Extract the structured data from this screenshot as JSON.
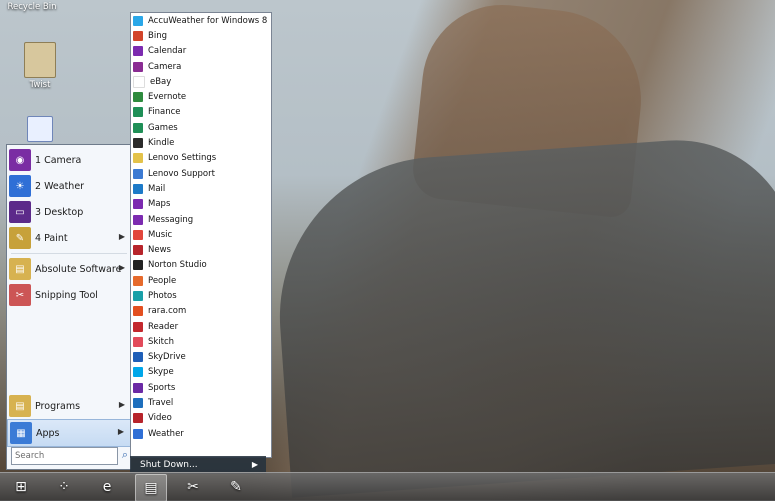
{
  "desktop": {
    "icons": [
      {
        "label": "Recycle Bin",
        "icon": "recycle-bin-icon"
      },
      {
        "label": "Twist",
        "icon": "folder-icon"
      },
      {
        "label": "",
        "icon": "app-icon"
      }
    ]
  },
  "start_menu": {
    "left_items": [
      {
        "label": "1 Camera",
        "icon": "camera-icon",
        "color": "#7a2da3",
        "has_arrow": false
      },
      {
        "label": "2 Weather",
        "icon": "weather-icon",
        "color": "#2f6fd6",
        "has_arrow": false
      },
      {
        "label": "3 Desktop",
        "icon": "desktop-icon",
        "color": "#5c2a8a",
        "has_arrow": false
      },
      {
        "label": "4 Paint",
        "icon": "paint-icon",
        "color": "#c7a13a",
        "has_arrow": true
      },
      {
        "label": "Absolute Software",
        "icon": "folder-icon",
        "color": "#d7b250",
        "has_arrow": true
      },
      {
        "label": "Snipping Tool",
        "icon": "scissors-icon",
        "color": "#c55",
        "has_arrow": false
      }
    ],
    "bottom_items": [
      {
        "label": "Programs",
        "icon": "programs-icon",
        "color": "#d7b250",
        "has_arrow": true
      },
      {
        "label": "Apps",
        "icon": "apps-icon",
        "color": "#3b7bd6",
        "has_arrow": true
      }
    ],
    "search": {
      "placeholder": "Search"
    },
    "shutdown_label": "Shut Down..."
  },
  "apps_list": [
    {
      "name": "AccuWeather for Windows 8",
      "color": "#2aa7e8"
    },
    {
      "name": "Bing",
      "color": "#d2442a"
    },
    {
      "name": "Calendar",
      "color": "#7c2bb0"
    },
    {
      "name": "Camera",
      "color": "#8a2c93"
    },
    {
      "name": "eBay",
      "color": "#ffffff"
    },
    {
      "name": "Evernote",
      "color": "#2e8b3e"
    },
    {
      "name": "Finance",
      "color": "#1f8f57"
    },
    {
      "name": "Games",
      "color": "#1f8f57"
    },
    {
      "name": "Kindle",
      "color": "#2b2b2b"
    },
    {
      "name": "Lenovo Settings",
      "color": "#e3c24a"
    },
    {
      "name": "Lenovo Support",
      "color": "#3c7ad3"
    },
    {
      "name": "Mail",
      "color": "#1d7ac8"
    },
    {
      "name": "Maps",
      "color": "#7c2bb0"
    },
    {
      "name": "Messaging",
      "color": "#7c2bb0"
    },
    {
      "name": "Music",
      "color": "#e2463c"
    },
    {
      "name": "News",
      "color": "#b7242b"
    },
    {
      "name": "Norton Studio",
      "color": "#222222"
    },
    {
      "name": "People",
      "color": "#e66a2c"
    },
    {
      "name": "Photos",
      "color": "#1aa0a8"
    },
    {
      "name": "rara.com",
      "color": "#e34f20"
    },
    {
      "name": "Reader",
      "color": "#c3282e"
    },
    {
      "name": "Skitch",
      "color": "#e24b5b"
    },
    {
      "name": "SkyDrive",
      "color": "#1f5fb8"
    },
    {
      "name": "Skype",
      "color": "#00a7ea"
    },
    {
      "name": "Sports",
      "color": "#6b2aa5"
    },
    {
      "name": "Travel",
      "color": "#1e6fbd"
    },
    {
      "name": "Video",
      "color": "#b7242b"
    },
    {
      "name": "Weather",
      "color": "#2f6fd6"
    }
  ],
  "taskbar": {
    "items": [
      {
        "icon": "windows-start-icon",
        "active": false
      },
      {
        "icon": "dots-app-icon",
        "active": false
      },
      {
        "icon": "internet-explorer-icon",
        "active": false
      },
      {
        "icon": "file-explorer-icon",
        "active": true
      },
      {
        "icon": "snipping-tool-icon",
        "active": false
      },
      {
        "icon": "paint-icon",
        "active": false
      }
    ]
  }
}
